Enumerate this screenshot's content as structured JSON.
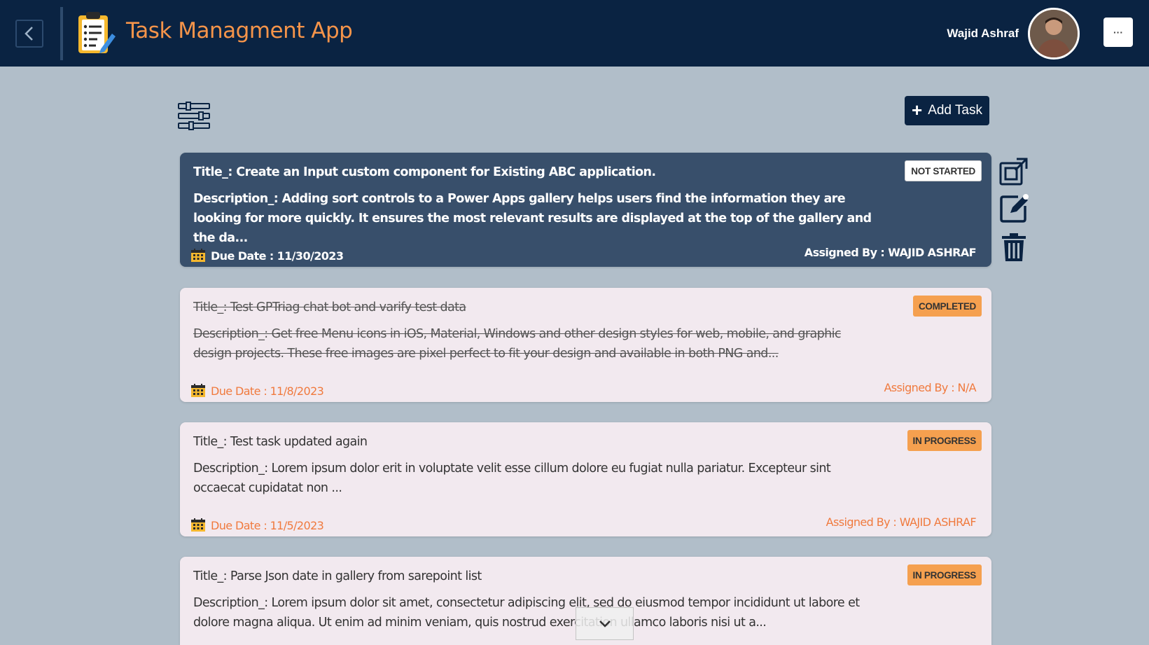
{
  "header": {
    "app_title": "Task Managment App",
    "user_name": "Wajid Ashraf",
    "more_label": "···"
  },
  "toolbar": {
    "add_task_label": "Add Task"
  },
  "tasks": [
    {
      "title": "Title_: Create an Input custom component for Existing ABC application.",
      "description": "Description_: Adding sort controls to a Power Apps gallery helps users find the information they are looking for more quickly. It ensures the most relevant results are displayed at the top of the gallery and the da...",
      "status": "NOT STARTED",
      "due_date": "Due Date : 11/30/2023",
      "assigned_by": "Assigned By : WAJID ASHRAF"
    },
    {
      "title": "Title_: Test GPTriag chat bot and varify test data",
      "description": "Description_: Get free Menu icons in iOS, Material, Windows and other design styles for web, mobile, and graphic design projects. These free images are pixel perfect to fit your design and available in both PNG and...",
      "status": "COMPLETED",
      "due_date": "Due Date : 11/8/2023",
      "assigned_by": "Assigned By : N/A"
    },
    {
      "title": "Title_: Test  task updated again",
      "description": "Description_: Lorem ipsum dolor erit in voluptate velit esse cillum dolore eu fugiat nulla pariatur. Excepteur sint occaecat cupidatat non ...",
      "status": "IN PROGRESS",
      "due_date": "Due Date : 11/5/2023",
      "assigned_by": "Assigned By : WAJID ASHRAF"
    },
    {
      "title": "Title_: Parse Json date in gallery from sarepoint list",
      "description": "Description_: Lorem ipsum dolor sit amet, consectetur adipiscing elit, sed do eiusmod tempor incididunt ut labore et dolore magna aliqua. Ut enim ad minim veniam, quis nostrud exercitation ullamco laboris nisi ut a...",
      "status": "IN PROGRESS"
    }
  ],
  "colors": {
    "header_bg": "#0a2342",
    "page_bg": "#b1bec9",
    "accent_orange": "#f5944a",
    "selected_card_bg": "#384f6b",
    "card_bg": "#f2e9ef"
  },
  "icons": [
    "back-icon",
    "clipboard-logo-icon",
    "filter-sliders-icon",
    "plus-icon",
    "open-external-icon",
    "edit-icon",
    "trash-icon",
    "calendar-icon",
    "chevron-down-icon"
  ]
}
